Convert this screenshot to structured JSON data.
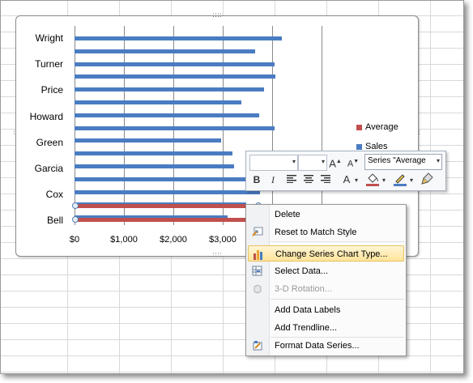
{
  "chart_data": {
    "type": "bar",
    "orientation": "horizontal",
    "xlim": [
      0,
      4000
    ],
    "x_tick_labels": [
      "$0",
      "$1,000",
      "$2,000",
      "$3,000"
    ],
    "y_tick_labels": [
      "Wright",
      "Turner",
      "Price",
      "Howard",
      "Green",
      "Garcia",
      "Cox",
      "Bell"
    ],
    "legend": [
      "Average",
      "Sales"
    ],
    "legend_position": "right",
    "series": [
      {
        "name": "Sales",
        "color": "#4a7cc2",
        "values": [
          4200,
          3650,
          4050,
          4070,
          3830,
          3380,
          3740,
          4050,
          2970,
          3190,
          3230,
          3710,
          3750,
          3480,
          3100
        ]
      },
      {
        "name": "Average",
        "color": "#c0504d",
        "values": [
          3700,
          3700
        ]
      }
    ]
  },
  "mini_toolbar": {
    "series_selector": "Series \"Average",
    "font_size_arrow": "▾",
    "bold": "B",
    "italic": "I",
    "grow_font": "A",
    "shrink_font": "A",
    "font_color": "A"
  },
  "context_menu": {
    "items": [
      {
        "label": "Delete",
        "icon": "none",
        "disabled": false
      },
      {
        "label": "Reset to Match Style",
        "icon": "reset-icon",
        "disabled": false
      },
      {
        "label": "Change Series Chart Type...",
        "icon": "chart-type-icon",
        "disabled": false,
        "highlighted": true
      },
      {
        "label": "Select Data...",
        "icon": "select-data-icon",
        "disabled": false
      },
      {
        "label": "3-D Rotation...",
        "icon": "rotation-icon",
        "disabled": true
      },
      {
        "label": "Add Data Labels",
        "icon": "none",
        "disabled": false
      },
      {
        "label": "Add Trendline...",
        "icon": "none",
        "disabled": false
      },
      {
        "label": "Format Data Series...",
        "icon": "format-icon",
        "disabled": false
      }
    ]
  }
}
